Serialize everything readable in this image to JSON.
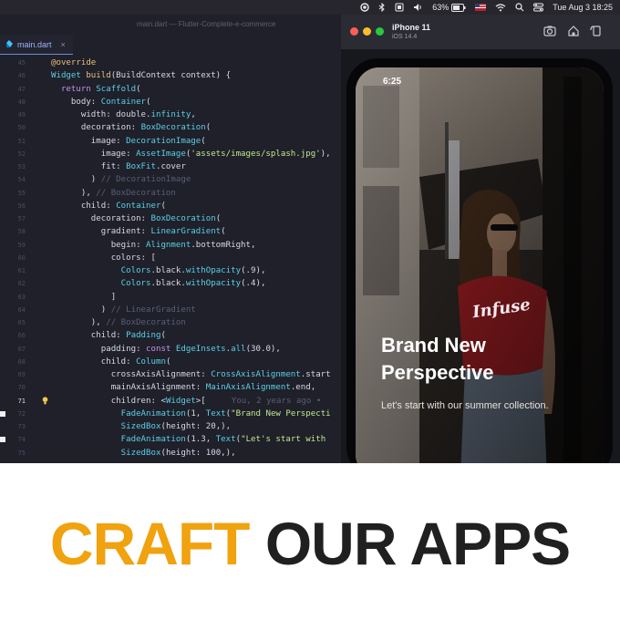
{
  "menubar": {
    "battery": "63%",
    "datetime": "Tue Aug 3  18:25"
  },
  "editor": {
    "window_title": "main.dart — Flutter-Complete-e-commerce",
    "tab_label": "main.dart",
    "tab_close": "×",
    "git_blame": "You, 2 years ago •",
    "lines": [
      {
        "num": "45",
        "parts": [
          [
            "k",
            "@override"
          ]
        ]
      },
      {
        "num": "46",
        "parts": [
          [
            "c",
            "Widget "
          ],
          [
            "k",
            "build"
          ],
          [
            "",
            "(BuildContext context) {"
          ]
        ]
      },
      {
        "num": "47",
        "parts": [
          [
            "",
            "  "
          ],
          [
            "kw",
            "return "
          ],
          [
            "c",
            "Scaffold"
          ],
          [
            "",
            "("
          ]
        ]
      },
      {
        "num": "48",
        "parts": [
          [
            "",
            "    body: "
          ],
          [
            "c",
            "Container"
          ],
          [
            "",
            "("
          ]
        ]
      },
      {
        "num": "49",
        "parts": [
          [
            "",
            "      width: double."
          ],
          [
            "c",
            "infinity"
          ],
          [
            "",
            ","
          ]
        ]
      },
      {
        "num": "50",
        "parts": [
          [
            "",
            "      decoration: "
          ],
          [
            "c",
            "BoxDecoration"
          ],
          [
            "",
            "("
          ]
        ]
      },
      {
        "num": "51",
        "parts": [
          [
            "",
            "        image: "
          ],
          [
            "c",
            "DecorationImage"
          ],
          [
            "",
            "("
          ]
        ]
      },
      {
        "num": "52",
        "parts": [
          [
            "",
            "          image: "
          ],
          [
            "c",
            "AssetImage"
          ],
          [
            "",
            "("
          ],
          [
            "s",
            "'assets/images/splash.jpg'"
          ],
          [
            "",
            "),"
          ]
        ]
      },
      {
        "num": "53",
        "parts": [
          [
            "",
            "          fit: "
          ],
          [
            "c",
            "BoxFit"
          ],
          [
            "",
            ".cover"
          ]
        ]
      },
      {
        "num": "54",
        "parts": [
          [
            "",
            "        ) "
          ],
          [
            "cm",
            "// DecorationImage"
          ]
        ]
      },
      {
        "num": "55",
        "parts": [
          [
            "",
            "      ), "
          ],
          [
            "cm",
            "// BoxDecoration"
          ]
        ]
      },
      {
        "num": "56",
        "parts": [
          [
            "",
            "      child: "
          ],
          [
            "c",
            "Container"
          ],
          [
            "",
            "("
          ]
        ]
      },
      {
        "num": "57",
        "parts": [
          [
            "",
            "        decoration: "
          ],
          [
            "c",
            "BoxDecoration"
          ],
          [
            "",
            "("
          ]
        ]
      },
      {
        "num": "58",
        "parts": [
          [
            "",
            "          gradient: "
          ],
          [
            "c",
            "LinearGradient"
          ],
          [
            "",
            "("
          ]
        ]
      },
      {
        "num": "59",
        "parts": [
          [
            "",
            "            begin: "
          ],
          [
            "c",
            "Alignment"
          ],
          [
            "",
            ".bottomRight,"
          ]
        ]
      },
      {
        "num": "60",
        "parts": [
          [
            "",
            "            colors: ["
          ]
        ]
      },
      {
        "num": "61",
        "parts": [
          [
            "",
            "              "
          ],
          [
            "c",
            "Colors"
          ],
          [
            "",
            ".black."
          ],
          [
            "c",
            "withOpacity"
          ],
          [
            "",
            "(.9),"
          ]
        ]
      },
      {
        "num": "62",
        "parts": [
          [
            "",
            "              "
          ],
          [
            "c",
            "Colors"
          ],
          [
            "",
            ".black."
          ],
          [
            "c",
            "withOpacity"
          ],
          [
            "",
            "(.4),"
          ]
        ]
      },
      {
        "num": "63",
        "parts": [
          [
            "",
            "            ]"
          ]
        ]
      },
      {
        "num": "64",
        "parts": [
          [
            "",
            "          ) "
          ],
          [
            "cm",
            "// LinearGradient"
          ]
        ]
      },
      {
        "num": "65",
        "parts": [
          [
            "",
            "        ), "
          ],
          [
            "cm",
            "// BoxDecoration"
          ]
        ]
      },
      {
        "num": "66",
        "parts": [
          [
            "",
            "        child: "
          ],
          [
            "c",
            "Padding"
          ],
          [
            "",
            "("
          ]
        ]
      },
      {
        "num": "67",
        "parts": [
          [
            "",
            "          padding: "
          ],
          [
            "kw",
            "const "
          ],
          [
            "c",
            "EdgeInsets"
          ],
          [
            "",
            "."
          ],
          [
            "c",
            "all"
          ],
          [
            "",
            "(30.0),"
          ]
        ]
      },
      {
        "num": "68",
        "parts": [
          [
            "",
            "          child: "
          ],
          [
            "c",
            "Column"
          ],
          [
            "",
            "("
          ]
        ]
      },
      {
        "num": "69",
        "parts": [
          [
            "",
            "            crossAxisAlignment: "
          ],
          [
            "c",
            "CrossAxisAlignment"
          ],
          [
            "",
            ".start"
          ]
        ]
      },
      {
        "num": "70",
        "parts": [
          [
            "",
            "            mainAxisAlignment: "
          ],
          [
            "c",
            "MainAxisAlignment"
          ],
          [
            "",
            ".end,"
          ]
        ]
      },
      {
        "num": "71",
        "parts": [
          [
            "",
            "            children: <"
          ],
          [
            "c",
            "Widget"
          ],
          [
            "",
            ">["
          ]
        ]
      },
      {
        "num": "72",
        "parts": [
          [
            "",
            "              "
          ],
          [
            "c",
            "FadeAnimation"
          ],
          [
            "",
            "(1, "
          ],
          [
            "c",
            "Text"
          ],
          [
            "",
            "("
          ],
          [
            "s",
            "\"Brand New Perspecti"
          ]
        ]
      },
      {
        "num": "73",
        "parts": [
          [
            "",
            "              "
          ],
          [
            "c",
            "SizedBox"
          ],
          [
            "",
            "(height: 20,),"
          ]
        ]
      },
      {
        "num": "74",
        "parts": [
          [
            "",
            "              "
          ],
          [
            "c",
            "FadeAnimation"
          ],
          [
            "",
            "(1.3, "
          ],
          [
            "c",
            "Text"
          ],
          [
            "",
            "("
          ],
          [
            "s",
            "\"Let's start with"
          ]
        ]
      },
      {
        "num": "75",
        "parts": [
          [
            "",
            "              "
          ],
          [
            "c",
            "SizedBox"
          ],
          [
            "",
            "(height: 100,),"
          ]
        ]
      }
    ]
  },
  "simulator": {
    "device_name": "iPhone 11",
    "ios_version": "iOS 14.4",
    "phone_time": "6:25",
    "hero_title": "Brand New Perspective",
    "hero_subtitle": "Let's start with our summer collection.",
    "shirt_text": "Infuse"
  },
  "banner": {
    "word1": "CRAFT",
    "word2": " OUR APPS",
    "accent": "#f0a20f",
    "dark": "#202020"
  }
}
